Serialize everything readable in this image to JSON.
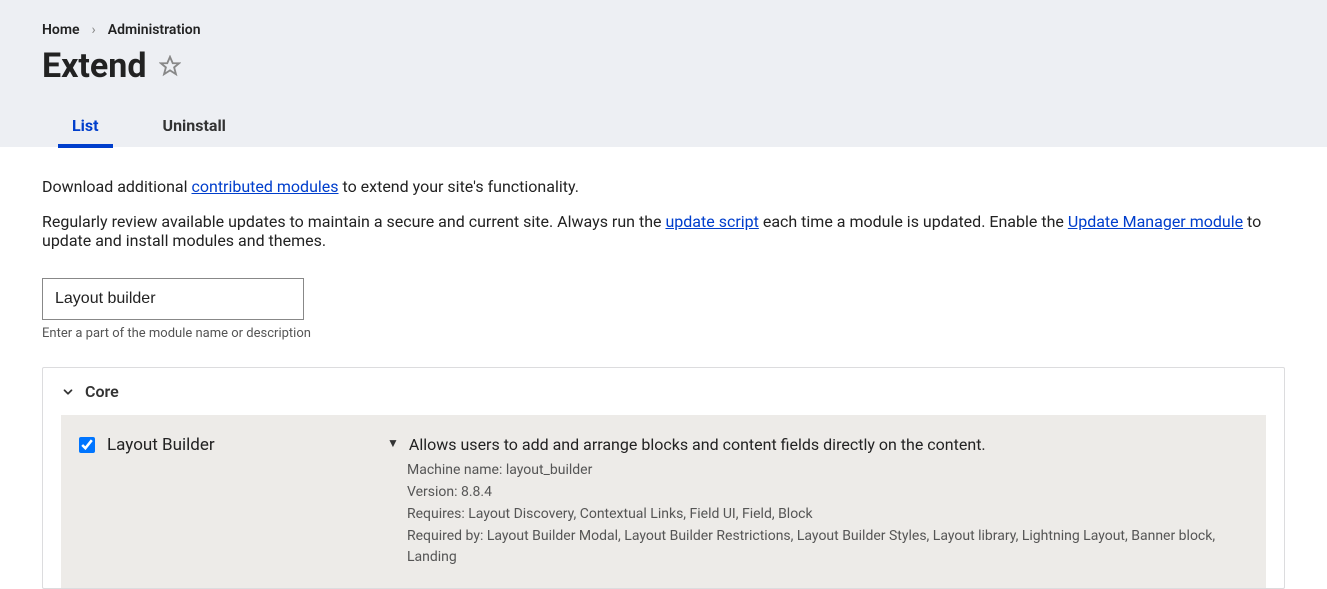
{
  "breadcrumb": {
    "home": "Home",
    "admin": "Administration"
  },
  "page_title": "Extend",
  "tabs": {
    "list": "List",
    "uninstall": "Uninstall"
  },
  "intro": {
    "p1_before": "Download additional ",
    "p1_link": "contributed modules",
    "p1_after": " to extend your site's functionality.",
    "p2_a": "Regularly review available updates to maintain a secure and current site. Always run the ",
    "p2_link1": "update script",
    "p2_b": " each time a module is updated. Enable the ",
    "p2_link2": "Update Manager module",
    "p2_c": " to update and install modules and themes."
  },
  "search": {
    "value": "Layout builder",
    "hint": "Enter a part of the module name or description"
  },
  "group": {
    "title": "Core"
  },
  "module": {
    "name": "Layout Builder",
    "summary": "Allows users to add and arrange blocks and content fields directly on the content.",
    "machine_label": "Machine name: ",
    "machine_name": "layout_builder",
    "version_label": "Version: ",
    "version": "8.8.4",
    "requires_label": "Requires: ",
    "requires": "Layout Discovery, Contextual Links, Field UI, Field, Block",
    "required_by_label": "Required by: ",
    "required_by": "Layout Builder Modal, Layout Builder Restrictions, Layout Builder Styles, Layout library, Lightning Layout, Banner block, Landing"
  }
}
